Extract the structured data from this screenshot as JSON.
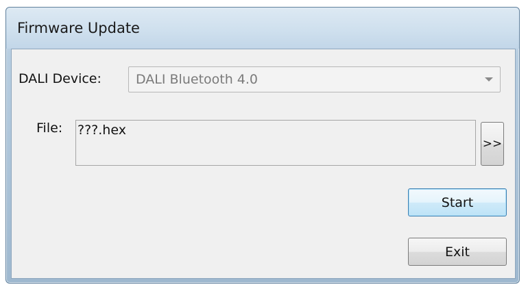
{
  "window": {
    "title": "Firmware Update"
  },
  "device": {
    "label": "DALI Device:",
    "selected": "DALI Bluetooth 4.0"
  },
  "file": {
    "label": "File:",
    "value": "???.hex",
    "browse_label": ">>"
  },
  "buttons": {
    "start_label": "Start",
    "exit_label": "Exit"
  },
  "icons": {
    "dropdown": "chevron-down-icon"
  },
  "colors": {
    "title_bar": "#cfe0ee",
    "client_bg": "#f0f0f0",
    "default_button_border": "#3c7fb1"
  }
}
